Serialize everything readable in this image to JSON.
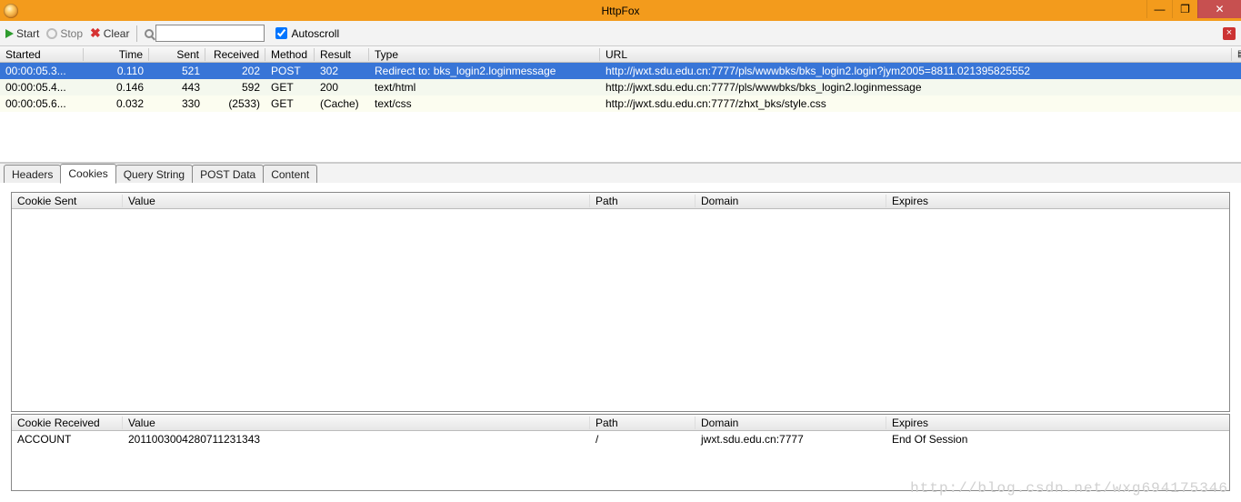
{
  "window": {
    "title": "HttpFox"
  },
  "toolbar": {
    "start": "Start",
    "stop": "Stop",
    "clear": "Clear",
    "autoscroll": "Autoscroll",
    "autoscroll_checked": true
  },
  "requests": {
    "columns": [
      "Started",
      "Time",
      "Sent",
      "Received",
      "Method",
      "Result",
      "Type",
      "URL"
    ],
    "rows": [
      {
        "started": "00:00:05.3...",
        "time": "0.110",
        "sent": "521",
        "received": "202",
        "method": "POST",
        "result": "302",
        "type": "Redirect to: bks_login2.loginmessage",
        "url": "http://jwxt.sdu.edu.cn:7777/pls/wwwbks/bks_login2.login?jym2005=8811.021395825552",
        "selected": true
      },
      {
        "started": "00:00:05.4...",
        "time": "0.146",
        "sent": "443",
        "received": "592",
        "method": "GET",
        "result": "200",
        "type": "text/html",
        "url": "http://jwxt.sdu.edu.cn:7777/pls/wwwbks/bks_login2.loginmessage",
        "alt": "alt"
      },
      {
        "started": "00:00:05.6...",
        "time": "0.032",
        "sent": "330",
        "received": "(2533)",
        "method": "GET",
        "result": "(Cache)",
        "type": "text/css",
        "url": "http://jwxt.sdu.edu.cn:7777/zhxt_bks/style.css",
        "alt": "alt2"
      }
    ]
  },
  "lower_tabs": [
    "Headers",
    "Cookies",
    "Query String",
    "POST Data",
    "Content"
  ],
  "active_lower_tab": 1,
  "cookies_sent": {
    "columns": [
      "Cookie Sent",
      "Value",
      "Path",
      "Domain",
      "Expires"
    ],
    "rows": []
  },
  "cookies_recv": {
    "columns": [
      "Cookie Received",
      "Value",
      "Path",
      "Domain",
      "Expires"
    ],
    "rows": [
      {
        "name": "ACCOUNT",
        "value": "2011003004280711231343",
        "path": "/",
        "domain": "jwxt.sdu.edu.cn:7777",
        "expires": "End Of Session"
      }
    ]
  },
  "watermark": "http://blog.csdn.net/wxg694175346"
}
